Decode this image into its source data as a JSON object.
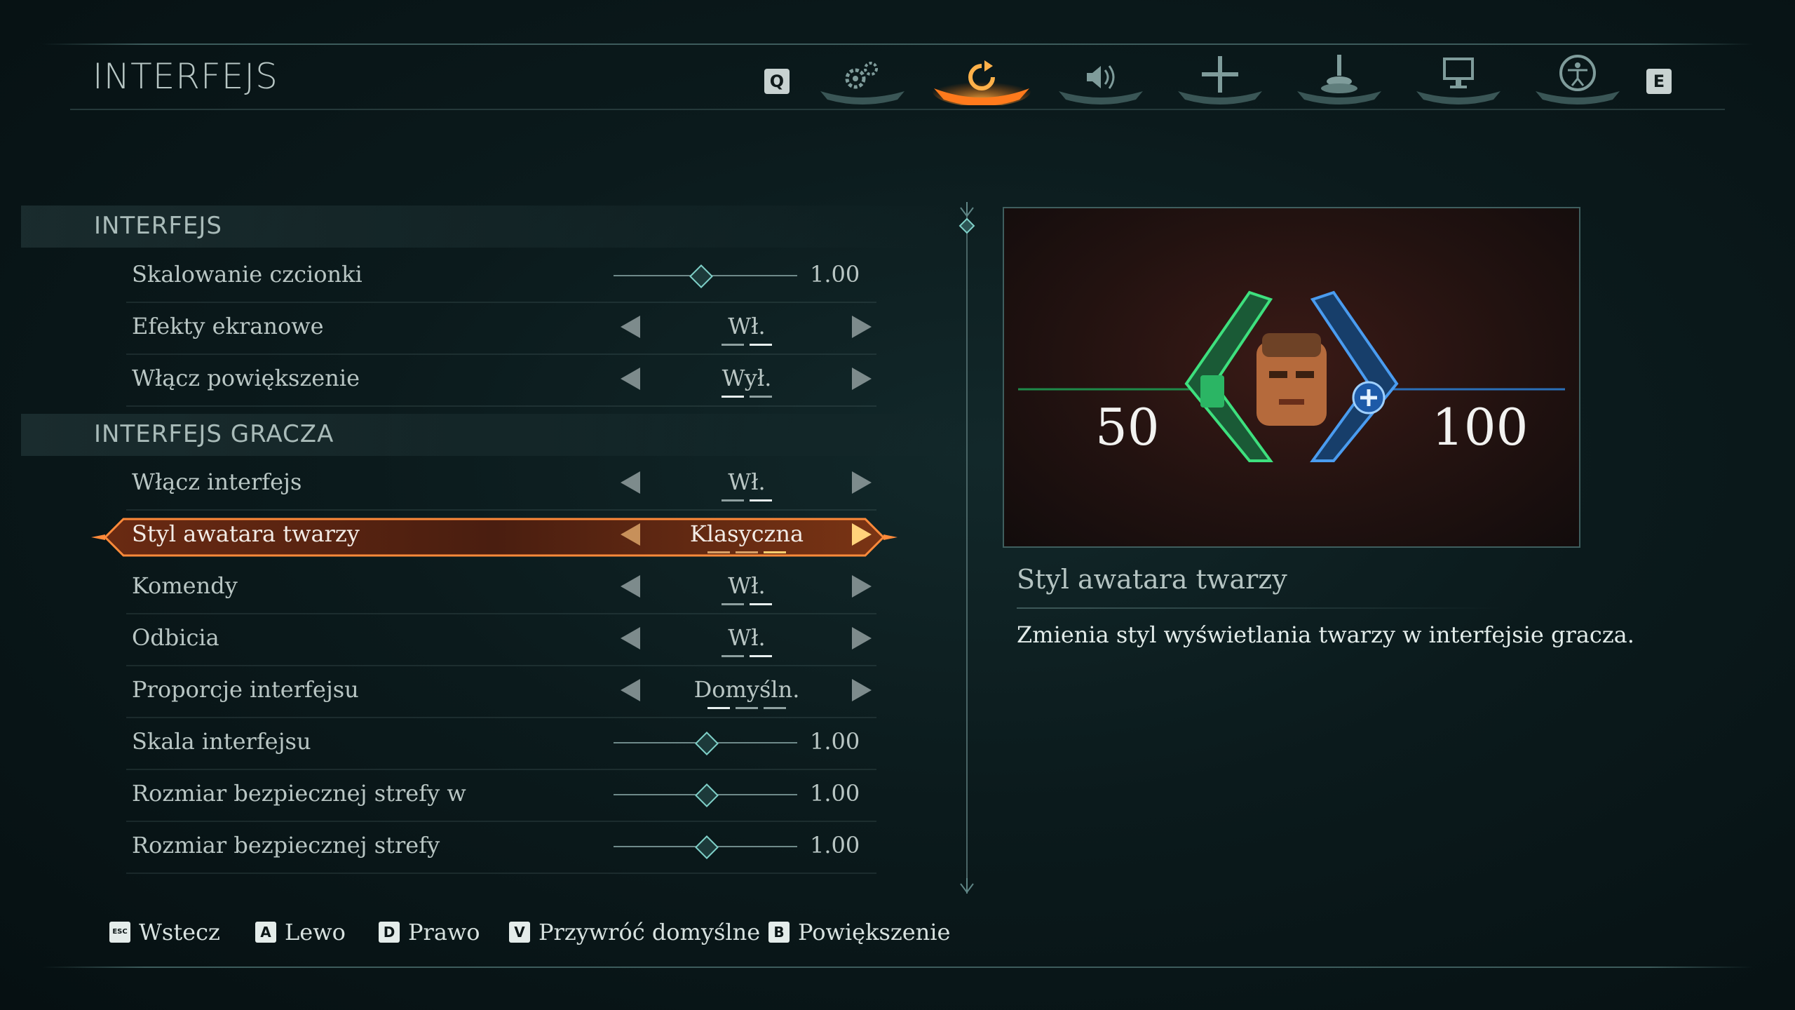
{
  "header": {
    "title": "INTERFEJS"
  },
  "tabs": {
    "prev_key": "Q",
    "next_key": "E",
    "items": [
      {
        "icon": "gears-icon"
      },
      {
        "icon": "refresh-icon",
        "active": true
      },
      {
        "icon": "speaker-icon"
      },
      {
        "icon": "crosshair-icon"
      },
      {
        "icon": "joystick-icon"
      },
      {
        "icon": "monitor-icon"
      },
      {
        "icon": "accessibility-icon"
      }
    ]
  },
  "sections": [
    {
      "title": "INTERFEJS",
      "rows": [
        {
          "label": "Skalowanie czcionki",
          "type": "slider",
          "value": "1.00",
          "level": 0.45
        },
        {
          "label": "Efekty ekranowe",
          "type": "toggle",
          "value": "Wł.",
          "pips": 2,
          "selected_pip": 2
        },
        {
          "label": "Włącz powiększenie",
          "type": "toggle",
          "value": "Wył.",
          "pips": 2,
          "selected_pip": 1
        }
      ]
    },
    {
      "title": "INTERFEJS GRACZA",
      "rows": [
        {
          "label": "Włącz interfejs",
          "type": "toggle",
          "value": "Wł.",
          "pips": 2,
          "selected_pip": 2
        },
        {
          "label": "Styl awatara twarzy",
          "type": "toggle",
          "value": "Klasyczna",
          "pips": 3,
          "selected_pip": 3,
          "selected": true
        },
        {
          "label": "Komendy",
          "type": "toggle",
          "value": "Wł.",
          "pips": 2,
          "selected_pip": 2
        },
        {
          "label": "Odbicia",
          "type": "toggle",
          "value": "Wł.",
          "pips": 2,
          "selected_pip": 2
        },
        {
          "label": "Proporcje interfejsu",
          "type": "toggle",
          "value": "Domyśln.",
          "pips": 3,
          "selected_pip": 1
        },
        {
          "label": "Skala interfejsu",
          "type": "slider",
          "value": "1.00",
          "level": 0.5
        },
        {
          "label": "Rozmiar bezpiecznej strefy w",
          "type": "slider",
          "value": "1.00",
          "level": 0.5
        },
        {
          "label": "Rozmiar bezpiecznej strefy",
          "type": "slider",
          "value": "1.00",
          "level": 0.5
        }
      ]
    }
  ],
  "preview": {
    "armor": "50",
    "health": "100"
  },
  "description": {
    "title": "Styl awatara twarzy",
    "text": "Zmienia styl wyświetlania twarzy w interfejsie gracza."
  },
  "footer": [
    {
      "key": "ESC",
      "label": "Wstecz"
    },
    {
      "key": "A",
      "label": "Lewo"
    },
    {
      "key": "D",
      "label": "Prawo"
    },
    {
      "key": "V",
      "label": "Przywróć domyślne"
    },
    {
      "key": "B",
      "label": "Powiększenie"
    }
  ],
  "colors": {
    "accent": "#ff8a2a",
    "armor_green": "#34d36a",
    "health_blue": "#3b8de0",
    "slider": "#7fd0c8"
  }
}
